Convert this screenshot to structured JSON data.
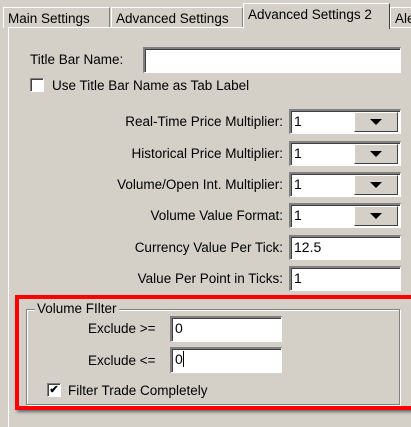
{
  "tabs": [
    {
      "label": "Main Settings"
    },
    {
      "label": "Advanced Settings"
    },
    {
      "label": "Advanced Settings 2"
    },
    {
      "label": "Ale"
    }
  ],
  "title_bar": {
    "label": "Title Bar Name:",
    "value": "",
    "use_as_tab_label": {
      "label": "Use Title Bar Name as Tab Label",
      "checked": false
    }
  },
  "rows": [
    {
      "label": "Real-Time Price Multiplier:",
      "value": "1",
      "type": "combo"
    },
    {
      "label": "Historical Price Multiplier:",
      "value": "1",
      "type": "combo"
    },
    {
      "label": "Volume/Open Int. Multiplier:",
      "value": "1",
      "type": "combo"
    },
    {
      "label": "Volume Value Format:",
      "value": "1",
      "type": "combo"
    },
    {
      "label": "Currency Value Per Tick:",
      "value": "12.5",
      "type": "text"
    },
    {
      "label": "Value Per Point in Ticks:",
      "value": "1",
      "type": "text"
    }
  ],
  "volume_filter": {
    "title": "Volume FIlter",
    "exclude_ge": {
      "label": "Exclude >=",
      "value": "0"
    },
    "exclude_le": {
      "label": "Exclude <=",
      "value": "0"
    },
    "filter_trade": {
      "label": "Filter Trade Completely",
      "checked": true,
      "mark": "✔"
    }
  },
  "colors": {
    "highlight": "#ff0000",
    "background": "#d4d0c8"
  }
}
